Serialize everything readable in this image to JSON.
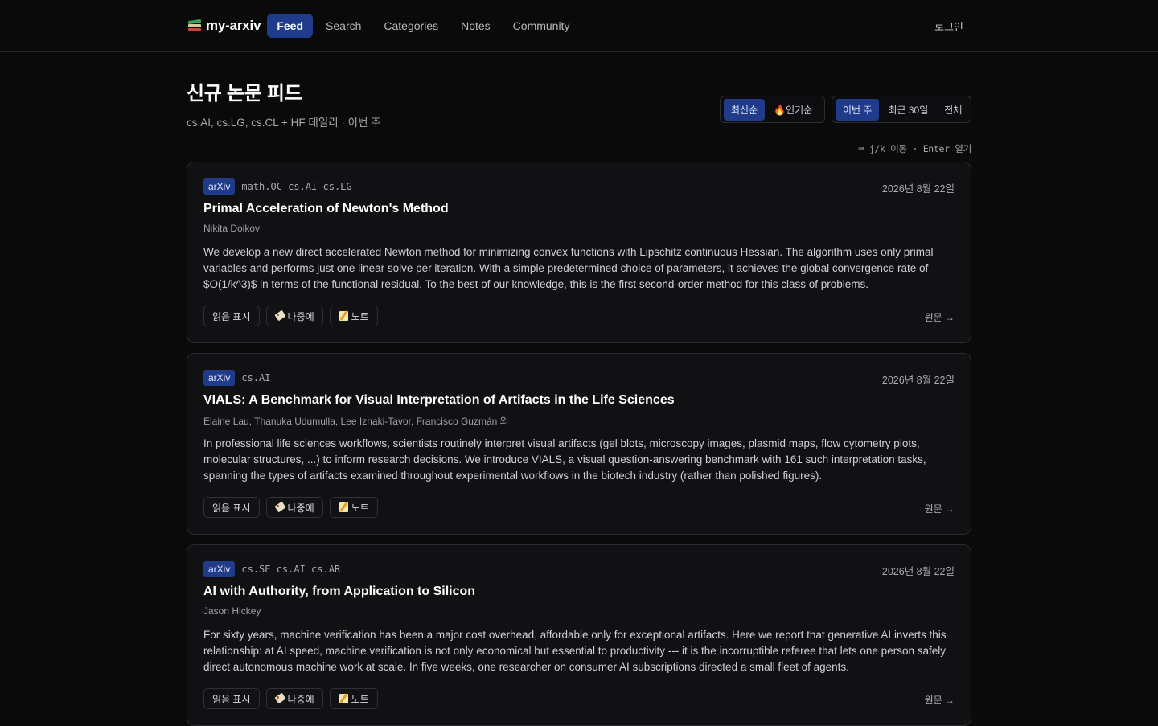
{
  "brand": {
    "name": "my-arxiv"
  },
  "nav": {
    "items": [
      {
        "label": "Feed",
        "active": true
      },
      {
        "label": "Search",
        "active": false
      },
      {
        "label": "Categories",
        "active": false
      },
      {
        "label": "Notes",
        "active": false
      },
      {
        "label": "Community",
        "active": false
      }
    ],
    "login": "로그인"
  },
  "header": {
    "title": "신규 논문 피드",
    "subtitle": "cs.AI, cs.LG, cs.CL + HF 데일리 · 이번 주"
  },
  "sort": {
    "latest": "최신순",
    "popular": "인기순",
    "selected": "최신순"
  },
  "range": {
    "week": "이번 주",
    "month": "최근 30일",
    "all": "전체",
    "selected": "이번 주"
  },
  "hint": "⌨ j/k 이동 · Enter 열기",
  "actions": {
    "mark_read": "읽음 표시",
    "later": "나중에",
    "note": "노트",
    "original": "원문 →"
  },
  "colors": {
    "accent": "#1f3b8a",
    "background": "#0a0a0b",
    "card": "#111113"
  },
  "papers": [
    {
      "source": "arXiv",
      "categories": "math.OC  cs.AI  cs.LG",
      "date": "2026년 8월 22일",
      "title": "Primal Acceleration of Newton's Method",
      "authors": "Nikita Doikov",
      "abstract": "We develop a new direct accelerated Newton method for minimizing convex functions with Lipschitz continuous Hessian. The algorithm uses only primal variables and performs just one linear solve per iteration. With a simple predetermined choice of parameters, it achieves the global convergence rate of $O(1/k^3)$ in terms of the functional residual. To the best of our knowledge, this is the first second-order method for this class of problems."
    },
    {
      "source": "arXiv",
      "categories": "cs.AI",
      "date": "2026년 8월 22일",
      "title": "VIALS: A Benchmark for Visual Interpretation of Artifacts in the Life Sciences",
      "authors": "Elaine Lau, Thanuka Udumulla, Lee Izhaki-Tavor, Francisco Guzmán 외",
      "abstract": "In professional life sciences workflows, scientists routinely interpret visual artifacts (gel blots, microscopy images, plasmid maps, flow cytometry plots, molecular structures, ...) to inform research decisions. We introduce VIALS, a visual question-answering benchmark with 161 such interpretation tasks, spanning the types of artifacts examined throughout experimental workflows in the biotech industry (rather than polished figures)."
    },
    {
      "source": "arXiv",
      "categories": "cs.SE  cs.AI  cs.AR",
      "date": "2026년 8월 22일",
      "title": "AI with Authority, from Application to Silicon",
      "authors": "Jason Hickey",
      "abstract": "For sixty years, machine verification has been a major cost overhead, affordable only for exceptional artifacts. Here we report that generative AI inverts this relationship: at AI speed, machine verification is not only economical but essential to productivity --- it is the incorruptible referee that lets one person safely direct autonomous machine work at scale. In five weeks, one researcher on consumer AI subscriptions directed a small fleet of agents."
    }
  ]
}
